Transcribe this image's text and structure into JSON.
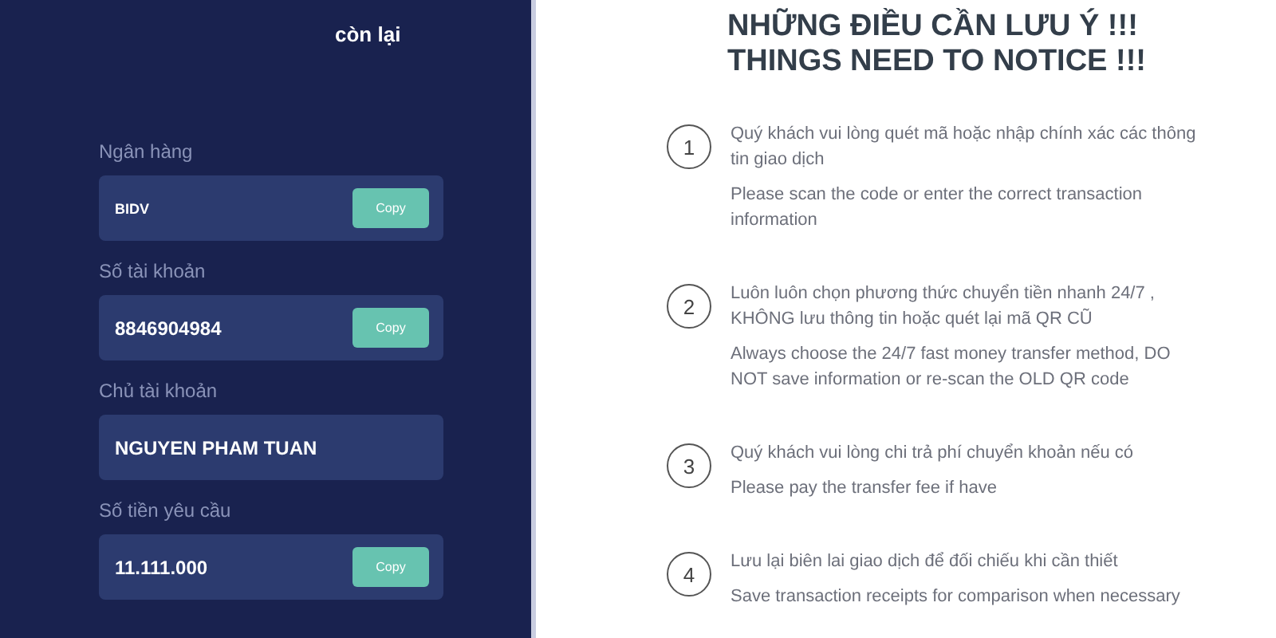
{
  "payment_panel": {
    "heading": "còn lại",
    "fields": [
      {
        "label": "Ngân hàng",
        "value": "BIDV",
        "button": "Copy"
      },
      {
        "label": "Số tài khoản",
        "value": "8846904984",
        "button": "Copy"
      },
      {
        "label": "Chủ tài khoản",
        "value": "NGUYEN PHAM TUAN"
      },
      {
        "label": "Số tiền yêu cầu",
        "value": "11.111.000",
        "button": "Copy"
      }
    ]
  },
  "notice": {
    "title_lines": [
      "NHỮNG ĐIỀU CẦN LƯU Ý !!!",
      "THINGS NEED TO NOTICE !!!"
    ],
    "items": [
      {
        "number": "1",
        "vi": "Quý khách vui lòng quét mã hoặc nhập chính xác các thông tin giao dịch",
        "en": "Please scan the code or enter the correct transaction information"
      },
      {
        "number": "2",
        "vi": "Luôn luôn chọn phương thức chuyển tiền nhanh 24/7 , KHÔNG lưu thông tin hoặc quét lại mã QR CŨ",
        "en": "Always choose the 24/7 fast money transfer method, DO NOT save information or re-scan the OLD QR code"
      },
      {
        "number": "3",
        "vi": "Quý khách vui lòng chi trả phí chuyển khoản nếu có",
        "en": "Please pay the transfer fee if have"
      },
      {
        "number": "4",
        "vi": "Lưu lại biên lai giao dịch để đối chiếu khi cần thiết",
        "en": "Save transaction receipts for comparison when necessary"
      }
    ]
  }
}
